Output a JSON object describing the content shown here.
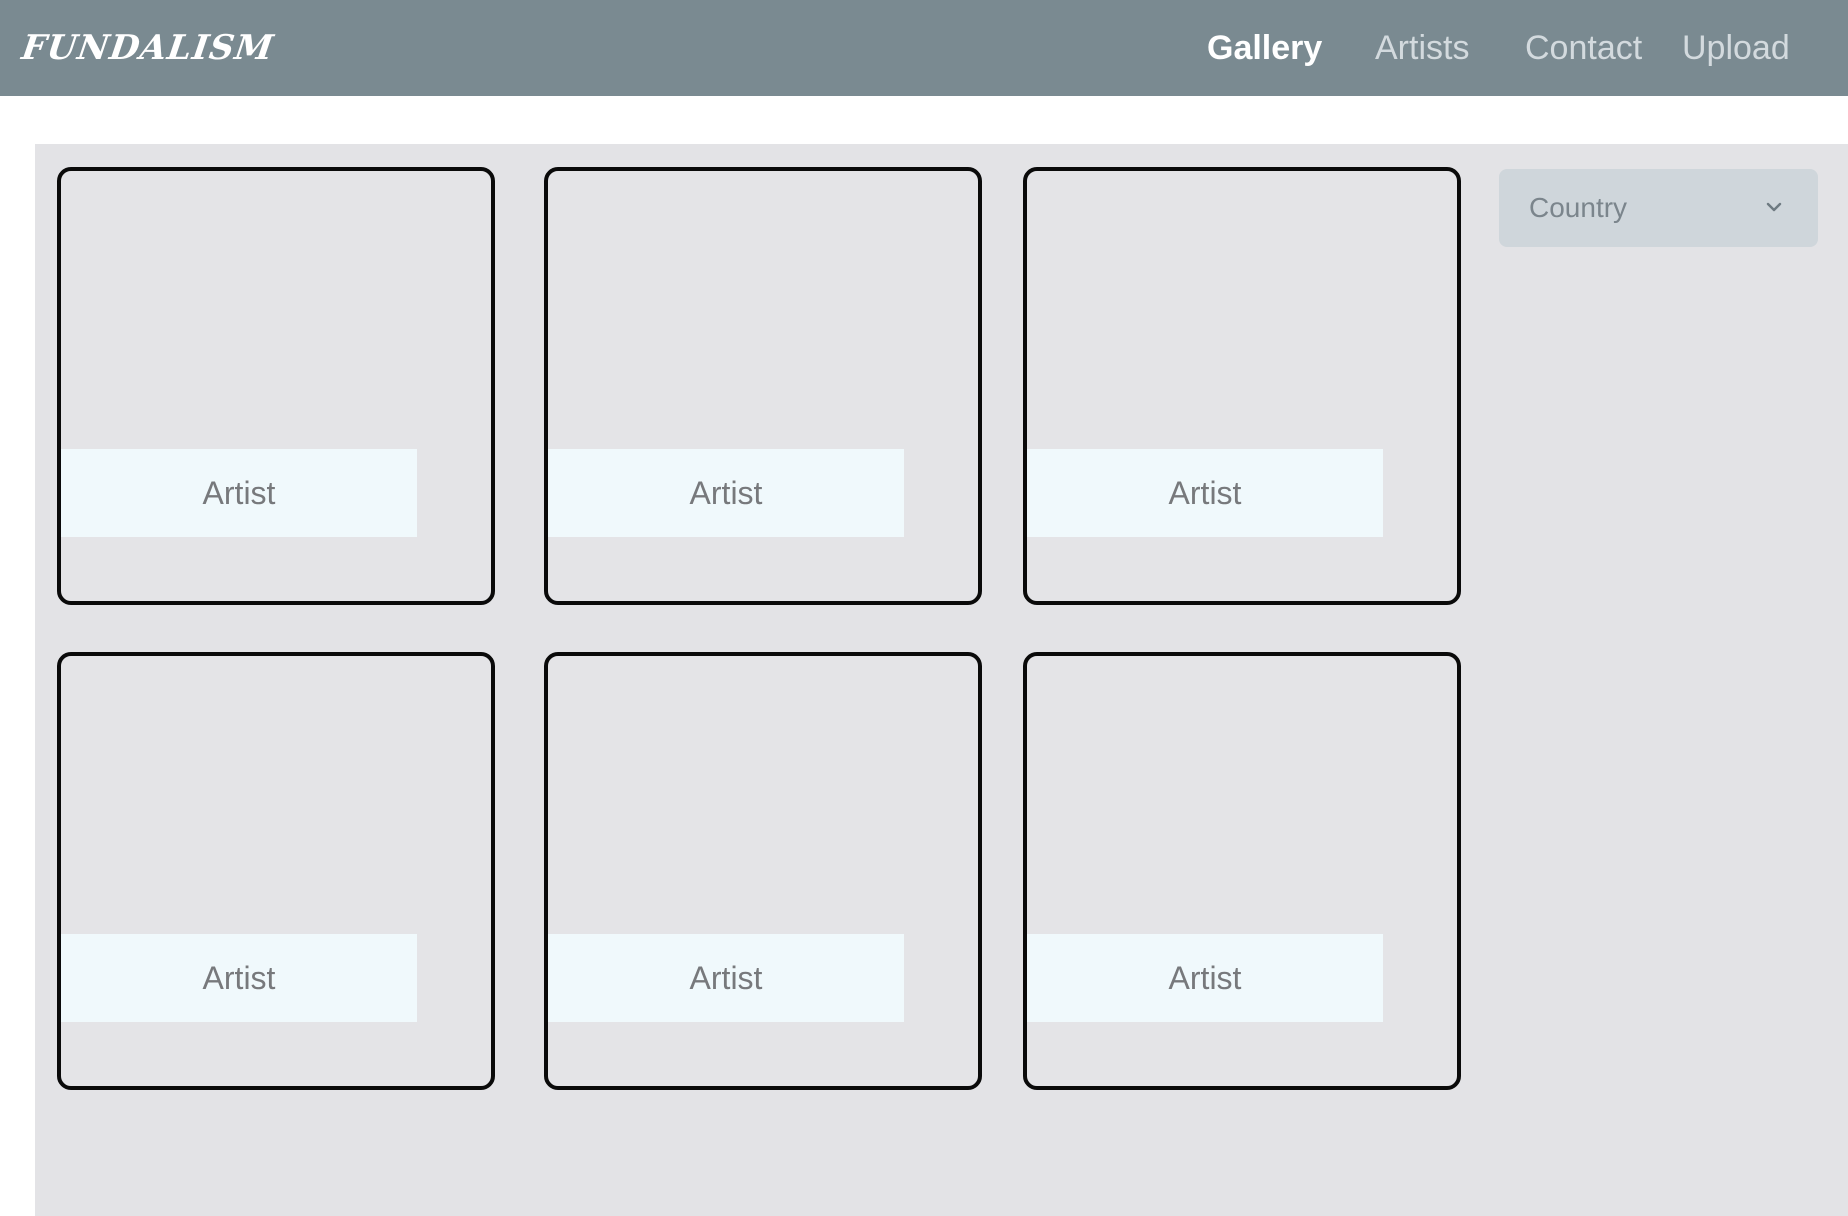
{
  "header": {
    "logo": "FUNDALISM",
    "nav": [
      {
        "label": "Gallery",
        "active": true
      },
      {
        "label": "Artists",
        "active": false
      },
      {
        "label": "Contact",
        "active": false
      },
      {
        "label": "Upload",
        "active": false
      }
    ]
  },
  "filter": {
    "country_label": "Country",
    "icon": "chevron-down-icon"
  },
  "gallery": {
    "cards": [
      {
        "label": "Artist"
      },
      {
        "label": "Artist"
      },
      {
        "label": "Artist"
      },
      {
        "label": "Artist"
      },
      {
        "label": "Artist"
      },
      {
        "label": "Artist"
      }
    ]
  },
  "colors": {
    "navbar": "#7a8a91",
    "content_bg": "#e3e3e6",
    "card_border": "#0a0a0a",
    "label_bg": "#f0f9fc",
    "select_bg": "#cfd6db"
  }
}
